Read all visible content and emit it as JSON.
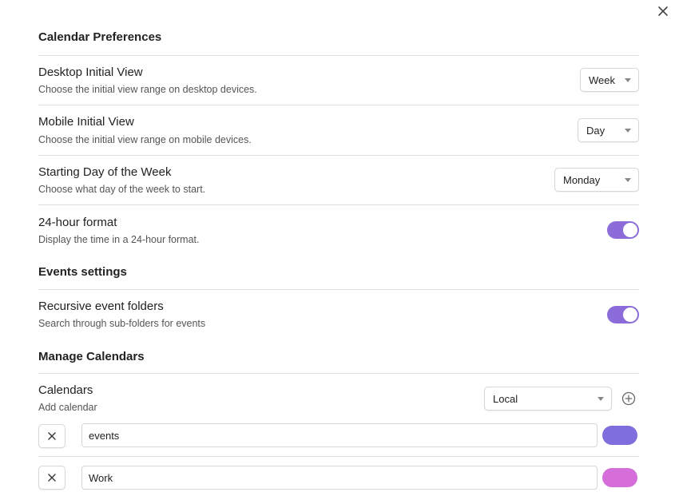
{
  "colors": {
    "toggle_on": "#8b6cd9",
    "events_color": "#7f6fdc",
    "work_color": "#d56ed8"
  },
  "calendar_preferences": {
    "heading": "Calendar Preferences",
    "desktop_view": {
      "name": "Desktop Initial View",
      "desc": "Choose the initial view range on desktop devices.",
      "value": "Week"
    },
    "mobile_view": {
      "name": "Mobile Initial View",
      "desc": "Choose the initial view range on mobile devices.",
      "value": "Day"
    },
    "start_day": {
      "name": "Starting Day of the Week",
      "desc": "Choose what day of the week to start.",
      "value": "Monday"
    },
    "hour_format": {
      "name": "24-hour format",
      "desc": "Display the time in a 24-hour format.",
      "enabled": true
    }
  },
  "events_settings": {
    "heading": "Events settings",
    "recursive": {
      "name": "Recursive event folders",
      "desc": "Search through sub-folders for events",
      "enabled": true
    }
  },
  "manage_calendars": {
    "heading": "Manage Calendars",
    "calendars": {
      "name": "Calendars",
      "desc": "Add calendar",
      "type_value": "Local"
    },
    "list": [
      {
        "name": "events",
        "color": "#7f6fdc"
      },
      {
        "name": "Work",
        "color": "#d56ed8"
      }
    ]
  }
}
